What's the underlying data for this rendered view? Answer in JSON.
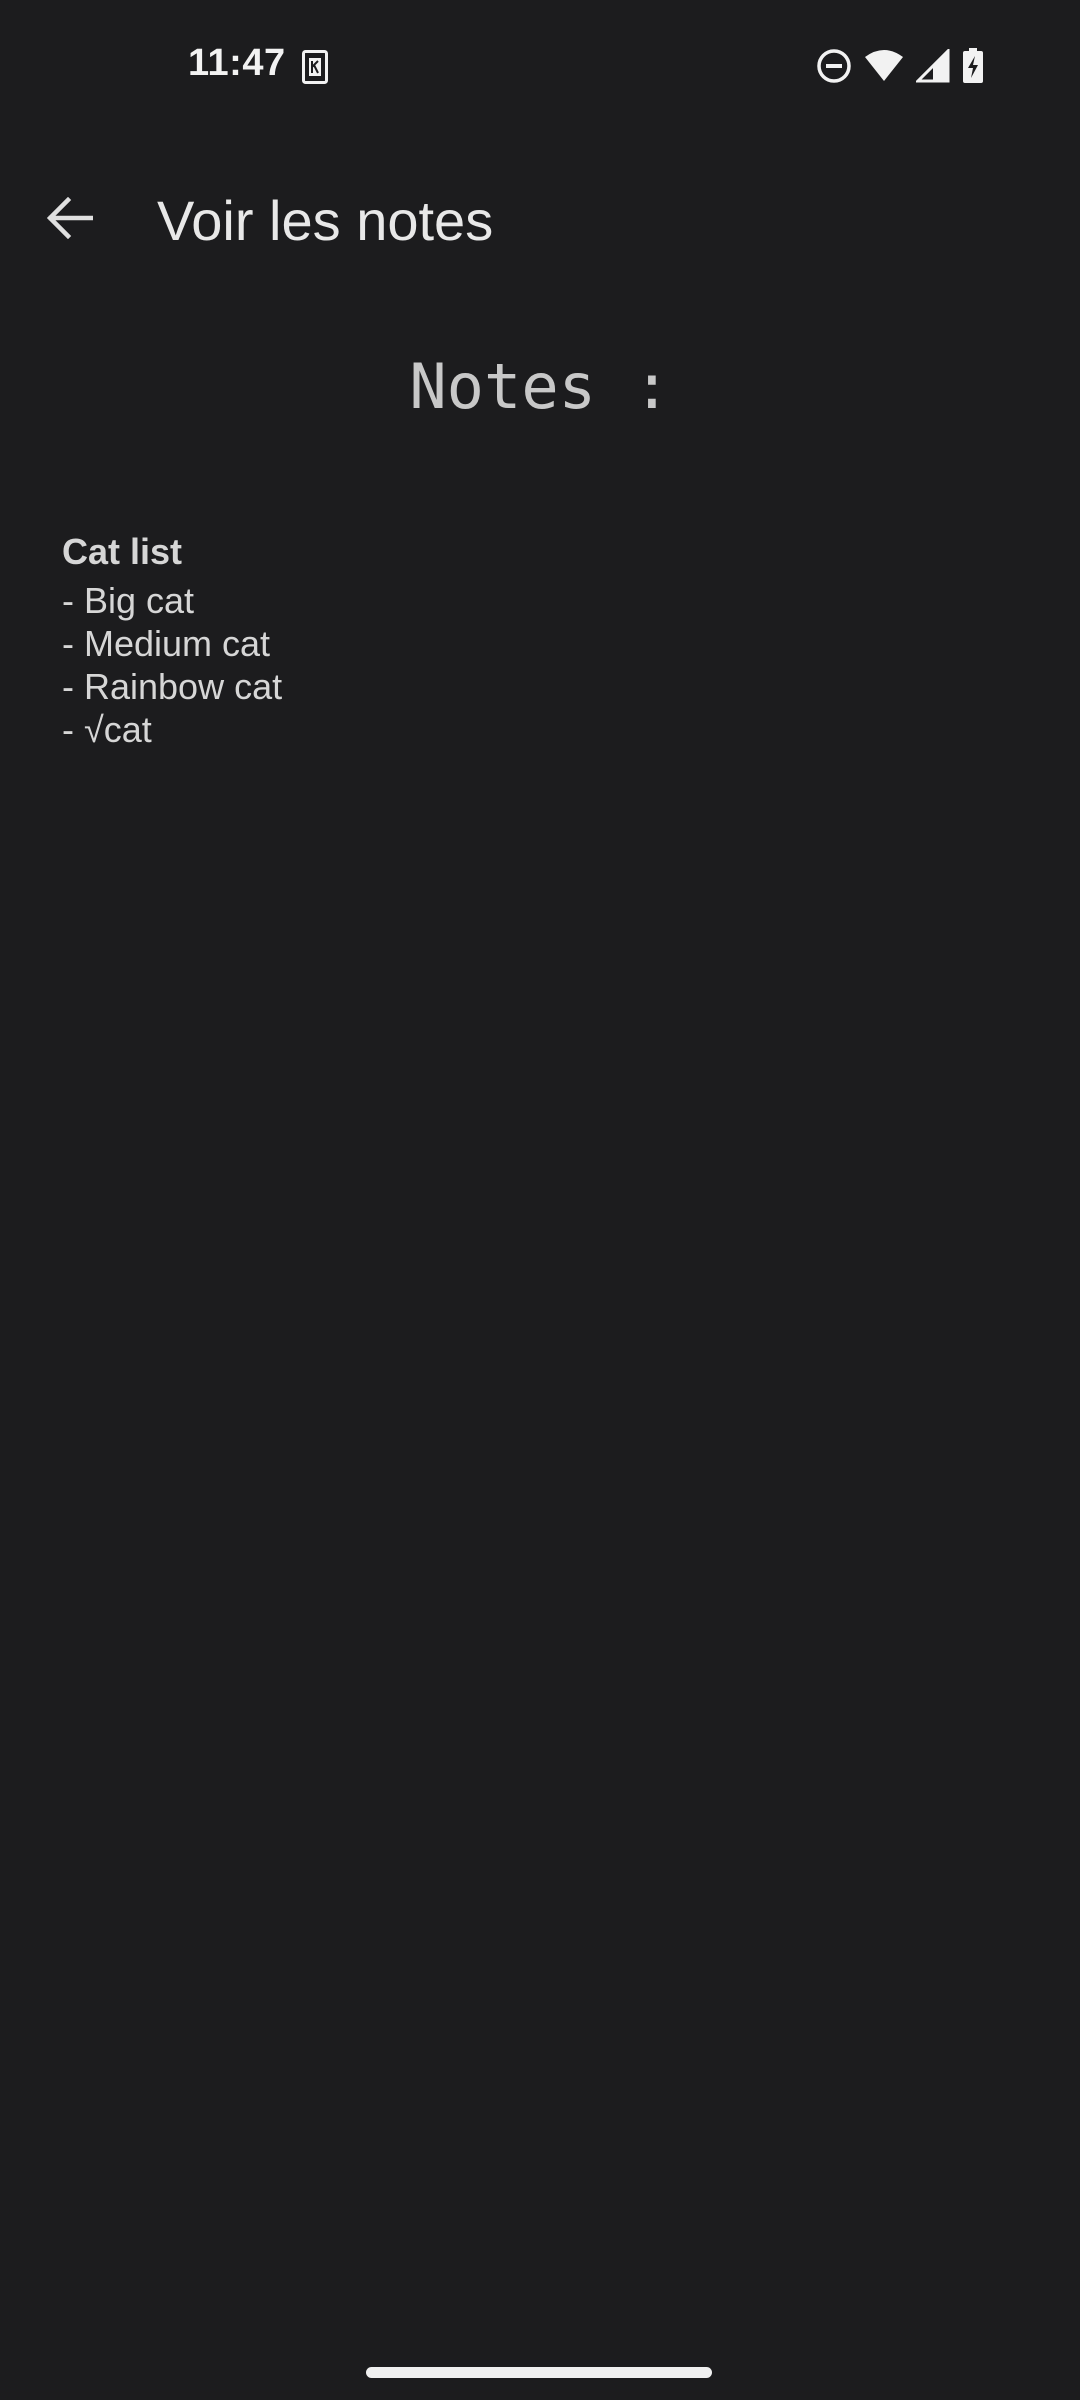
{
  "status_bar": {
    "time": "11:47",
    "icons": [
      "sim-card-icon",
      "do-not-disturb-icon",
      "wifi-icon",
      "signal-icon",
      "battery-charging-icon"
    ]
  },
  "app_bar": {
    "back_icon": "arrow-back-icon",
    "title": "Voir les notes"
  },
  "main": {
    "heading": "Notes :",
    "note": {
      "title": "Cat list",
      "lines": [
        "- Big cat",
        "- Medium cat",
        "- Rainbow cat",
        "- √cat"
      ]
    }
  },
  "colors": {
    "background": "#1c1c1e",
    "text": "#d6d6d6"
  }
}
